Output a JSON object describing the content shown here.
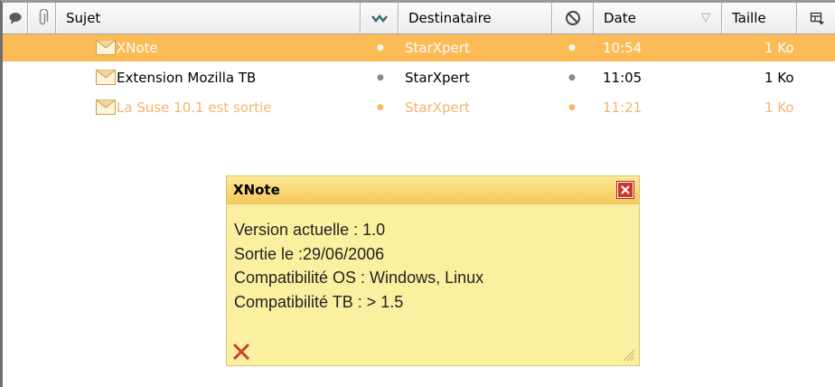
{
  "columns": {
    "thread_icon": "thread-icon",
    "attachment_icon": "paperclip-icon",
    "subject": "Sujet",
    "status_icon": "read-status-icon",
    "recipient": "Destinataire",
    "junk_icon": "junk-icon",
    "date": "Date",
    "size": "Taille",
    "picker_icon": "column-picker-icon"
  },
  "messages": [
    {
      "subject": "XNote",
      "recipient": "StarXpert",
      "date": "10:54",
      "size": "1 Ko",
      "state": "selected"
    },
    {
      "subject": "Extension Mozilla TB",
      "recipient": "StarXpert",
      "date": "11:05",
      "size": "1 Ko",
      "state": "read"
    },
    {
      "subject": "La Suse 10.1 est sortie",
      "recipient": "StarXpert",
      "date": "11:21",
      "size": "1 Ko",
      "state": "unread"
    }
  ],
  "note": {
    "title": "XNote",
    "lines": [
      "Version actuelle : 1.0",
      "Sortie le :29/06/2006",
      "Compatibilité OS : Windows, Linux",
      "Compatibilité TB : > 1.5"
    ]
  },
  "colors": {
    "selected_row": "#fdbb56",
    "unread_text": "#f7b46b",
    "note_background": "#fbf0a0",
    "note_close": "#d2352b"
  }
}
